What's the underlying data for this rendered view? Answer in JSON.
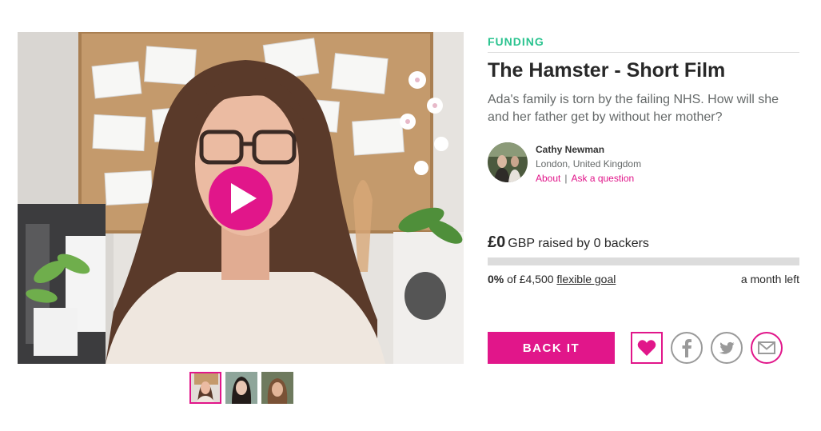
{
  "project": {
    "status_label": "FUNDING",
    "title": "The Hamster - Short Film",
    "blurb": "Ada's family is torn by the failing NHS. How will she and her father get by without her mother?"
  },
  "creator": {
    "name": "Cathy Newman",
    "location": "London, United Kingdom",
    "about_link": "About",
    "separator": "|",
    "ask_link": "Ask a question"
  },
  "funding": {
    "amount": "£0",
    "amount_desc": "GBP raised by 0 backers",
    "percent_label": "0%",
    "goal_prefix": "of £4,500",
    "goal_type": "flexible goal",
    "time_left": "a month left",
    "progress_fraction": 0
  },
  "actions": {
    "back_label": "BACK IT",
    "follow_icon": "heart-icon",
    "facebook_icon": "facebook-icon",
    "twitter_icon": "twitter-icon",
    "email_icon": "email-icon"
  },
  "media": {
    "play_icon": "play-icon",
    "thumbnail_count": 3,
    "active_thumbnail": 0
  },
  "colors": {
    "accent": "#e1168a",
    "status_green": "#2ac38f",
    "muted_text": "#656969",
    "track": "#dcdcdc"
  }
}
